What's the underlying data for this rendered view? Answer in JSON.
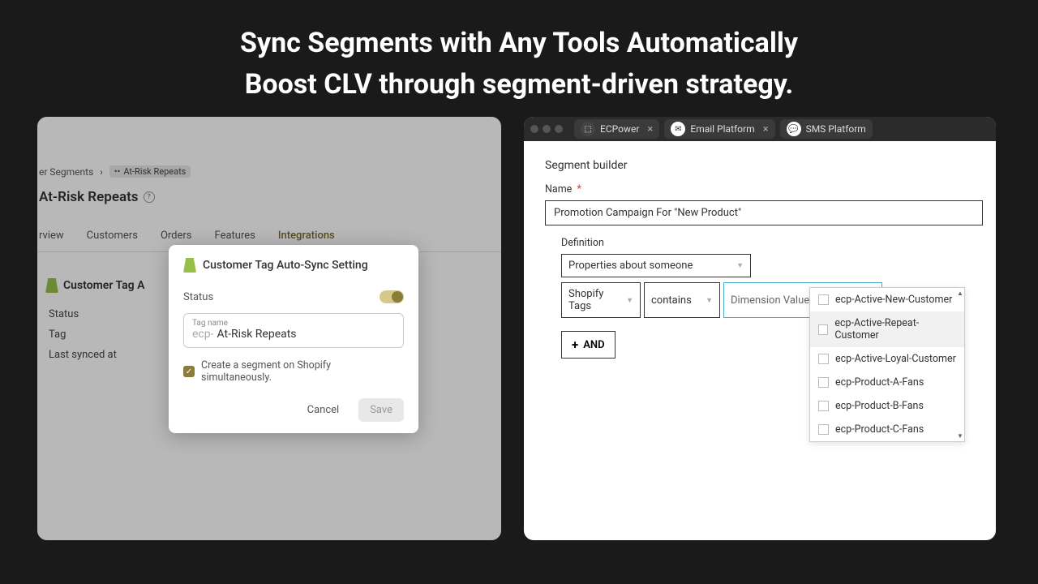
{
  "headline": {
    "line1": "Sync Segments with Any Tools Automatically",
    "line2": "Boost CLV through segment-driven strategy."
  },
  "left": {
    "breadcrumb": {
      "parent": "er Segments",
      "current": "At-Risk Repeats"
    },
    "page_title": "At-Risk Repeats",
    "tabs": [
      "rview",
      "Customers",
      "Orders",
      "Features",
      "Integrations"
    ],
    "active_tab": 4,
    "section_title": "Customer Tag A",
    "kv": [
      "Status",
      "Tag",
      "Last synced at"
    ],
    "modal": {
      "title": "Customer Tag Auto-Sync Setting",
      "status_label": "Status",
      "tag_label": "Tag name",
      "tag_prefix": "ecp-",
      "tag_value": "At-Risk Repeats",
      "checkbox_label": "Create a segment on Shopify simultaneously.",
      "cancel": "Cancel",
      "save": "Save"
    }
  },
  "right": {
    "window_tabs": [
      {
        "label": "ECPower",
        "closable": true
      },
      {
        "label": "Email Platform",
        "closable": true
      },
      {
        "label": "SMS Platform",
        "closable": false
      }
    ],
    "builder_title": "Segment builder",
    "name_label": "Name",
    "name_value": "Promotion Campaign For \"New Product\"",
    "definition_label": "Definition",
    "prop_select": "Properties about someone",
    "tag_select": "Shopify Tags",
    "op_select": "contains",
    "dim_placeholder": "Dimension Value",
    "and_label": "AND",
    "dropdown_items": [
      "ecp-Active-New-Customer",
      "ecp-Active-Repeat-Customer",
      "ecp-Active-Loyal-Customer",
      "ecp-Product-A-Fans",
      "ecp-Product-B-Fans",
      "ecp-Product-C-Fans"
    ],
    "dropdown_highlight": 1
  }
}
